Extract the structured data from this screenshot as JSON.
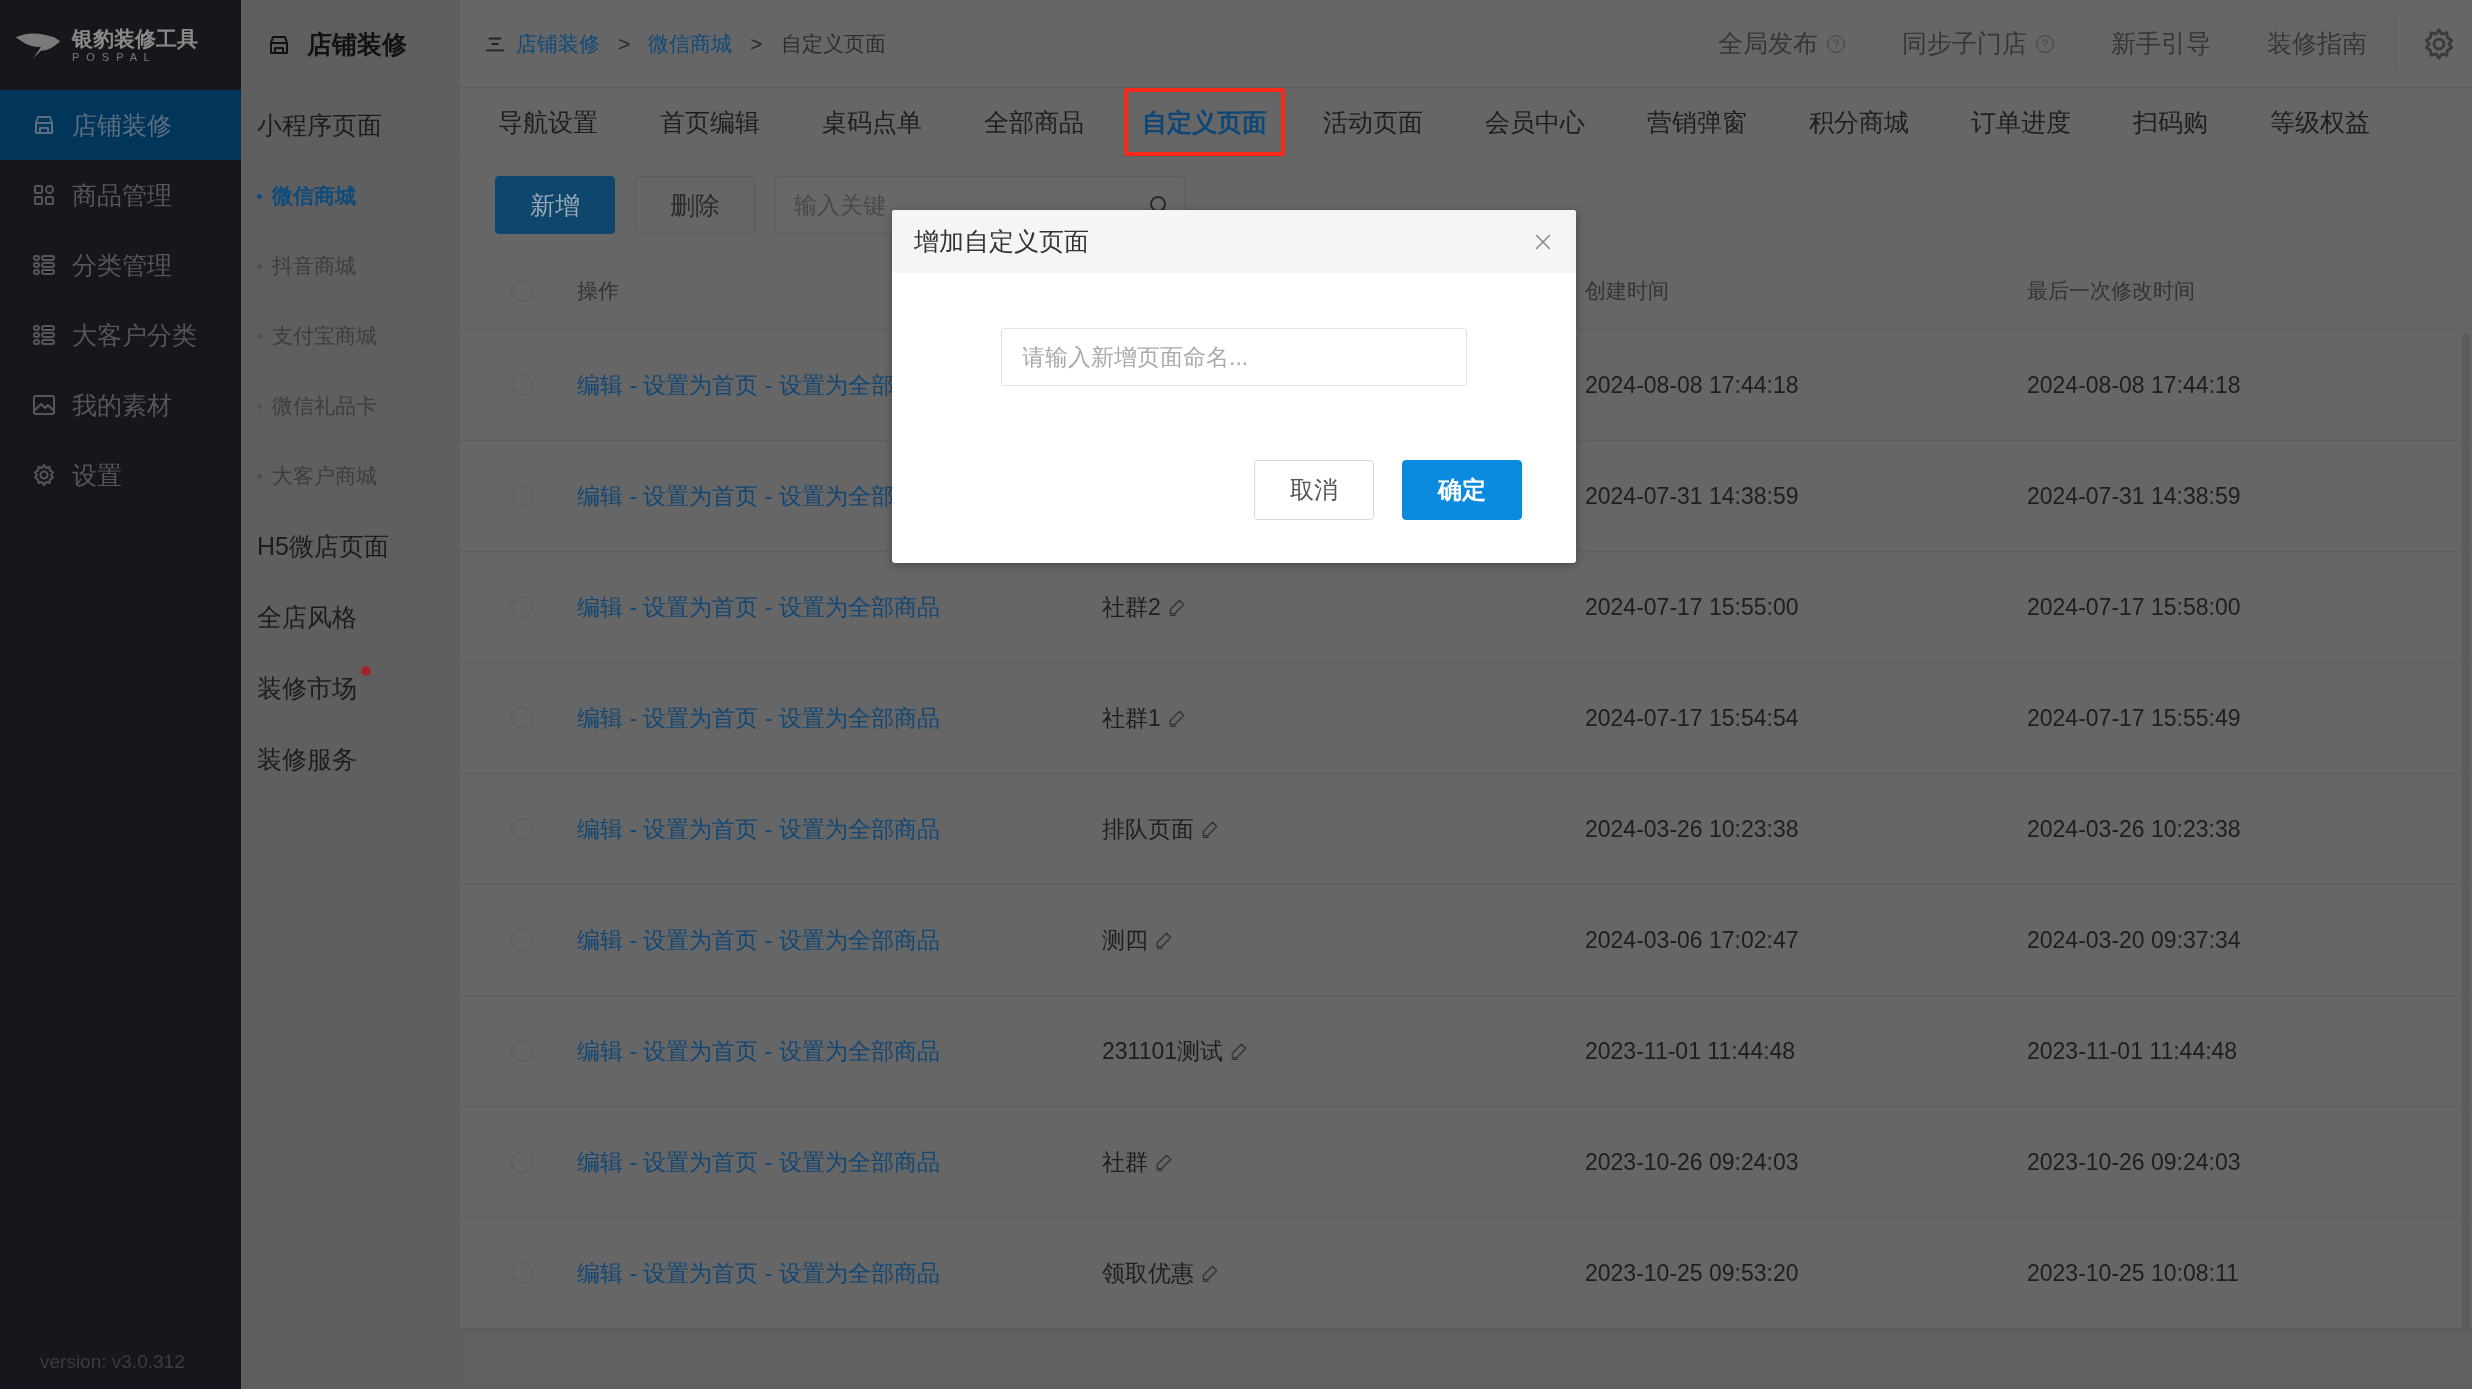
{
  "app": {
    "logo_title": "银豹装修工具",
    "logo_subtitle": "P O S P A L",
    "version": "version: v3.0.312"
  },
  "sidebar": {
    "items": [
      {
        "label": "店铺装修",
        "selected": true
      },
      {
        "label": "商品管理",
        "selected": false
      },
      {
        "label": "分类管理",
        "selected": false
      },
      {
        "label": "大客户分类",
        "selected": false
      },
      {
        "label": "我的素材",
        "selected": false
      },
      {
        "label": "设置",
        "selected": false
      }
    ]
  },
  "subnav": {
    "title": "店铺装修",
    "items": [
      {
        "label": "小程序页面",
        "dot": false,
        "children": [
          {
            "label": "微信商城",
            "selected": true
          },
          {
            "label": "抖音商城",
            "selected": false
          },
          {
            "label": "支付宝商城",
            "selected": false
          },
          {
            "label": "微信礼品卡",
            "selected": false
          },
          {
            "label": "大客户商城",
            "selected": false
          }
        ]
      },
      {
        "label": "H5微店页面",
        "dot": false
      },
      {
        "label": "全店风格",
        "dot": false
      },
      {
        "label": "装修市场",
        "dot": true
      },
      {
        "label": "装修服务",
        "dot": false
      }
    ]
  },
  "breadcrumb": {
    "separators": [
      ">",
      ">"
    ],
    "items": [
      {
        "label": "店铺装修",
        "link": true
      },
      {
        "label": "微信商城",
        "link": true
      },
      {
        "label": "自定义页面",
        "link": false
      }
    ]
  },
  "top_actions": [
    {
      "label": "全局发布",
      "help": true
    },
    {
      "label": "同步子门店",
      "help": true
    },
    {
      "label": "新手引导",
      "help": false
    },
    {
      "label": "装修指南",
      "help": false
    }
  ],
  "tabs": [
    {
      "label": "导航设置",
      "selected": false,
      "highlighted": false
    },
    {
      "label": "首页编辑",
      "selected": false,
      "highlighted": false
    },
    {
      "label": "桌码点单",
      "selected": false,
      "highlighted": false
    },
    {
      "label": "全部商品",
      "selected": false,
      "highlighted": false
    },
    {
      "label": "自定义页面",
      "selected": true,
      "highlighted": true
    },
    {
      "label": "活动页面",
      "selected": false,
      "highlighted": false
    },
    {
      "label": "会员中心",
      "selected": false,
      "highlighted": false
    },
    {
      "label": "营销弹窗",
      "selected": false,
      "highlighted": false
    },
    {
      "label": "积分商城",
      "selected": false,
      "highlighted": false
    },
    {
      "label": "订单进度",
      "selected": false,
      "highlighted": false
    },
    {
      "label": "扫码购",
      "selected": false,
      "highlighted": false
    },
    {
      "label": "等级权益",
      "selected": false,
      "highlighted": false
    }
  ],
  "toolbar": {
    "buttons": [
      "新增",
      "删除"
    ],
    "search": {
      "placeholder": "输入关键"
    }
  },
  "table": {
    "select_all": {
      "checked": false
    },
    "columns": [
      "操作",
      "创建时间",
      "最后一次修改时间"
    ],
    "rows": [
      {
        "checked": false,
        "actions": "编辑 - 设置为首页 - 设置为全部",
        "created": "2024-08-08 17:44:18",
        "modified": "2024-08-08 17:44:18"
      },
      {
        "checked": false,
        "actions": "编辑 - 设置为首页 - 设置为全部",
        "created": "2024-07-31 14:38:59",
        "modified": "2024-07-31 14:38:59"
      },
      {
        "checked": false,
        "actions": "编辑 - 设置为首页 - 设置为全部商品",
        "name": "社群2",
        "created": "2024-07-17 15:55:00",
        "modified": "2024-07-17 15:58:00"
      },
      {
        "checked": false,
        "actions": "编辑 - 设置为首页 - 设置为全部商品",
        "name": "社群1",
        "created": "2024-07-17 15:54:54",
        "modified": "2024-07-17 15:55:49"
      },
      {
        "checked": false,
        "actions": "编辑 - 设置为首页 - 设置为全部商品",
        "name": "排队页面",
        "created": "2024-03-26 10:23:38",
        "modified": "2024-03-26 10:23:38"
      },
      {
        "checked": false,
        "actions": "编辑 - 设置为首页 - 设置为全部商品",
        "name": "测四",
        "created": "2024-03-06 17:02:47",
        "modified": "2024-03-20 09:37:34"
      },
      {
        "checked": false,
        "actions": "编辑 - 设置为首页 - 设置为全部商品",
        "name": "231101测试",
        "created": "2023-11-01 11:44:48",
        "modified": "2023-11-01 11:44:48"
      },
      {
        "checked": false,
        "actions": "编辑 - 设置为首页 - 设置为全部商品",
        "name": "社群",
        "created": "2023-10-26 09:24:03",
        "modified": "2023-10-26 09:24:03"
      },
      {
        "checked": false,
        "actions": "编辑 - 设置为首页 - 设置为全部商品",
        "name": "领取优惠",
        "created": "2023-10-25 09:53:20",
        "modified": "2023-10-25 10:08:11"
      }
    ]
  },
  "dialog": {
    "title": "增加自定义页面",
    "input": {
      "placeholder": "请输入新增页面命名..."
    },
    "buttons": [
      "取消",
      "确定"
    ]
  }
}
